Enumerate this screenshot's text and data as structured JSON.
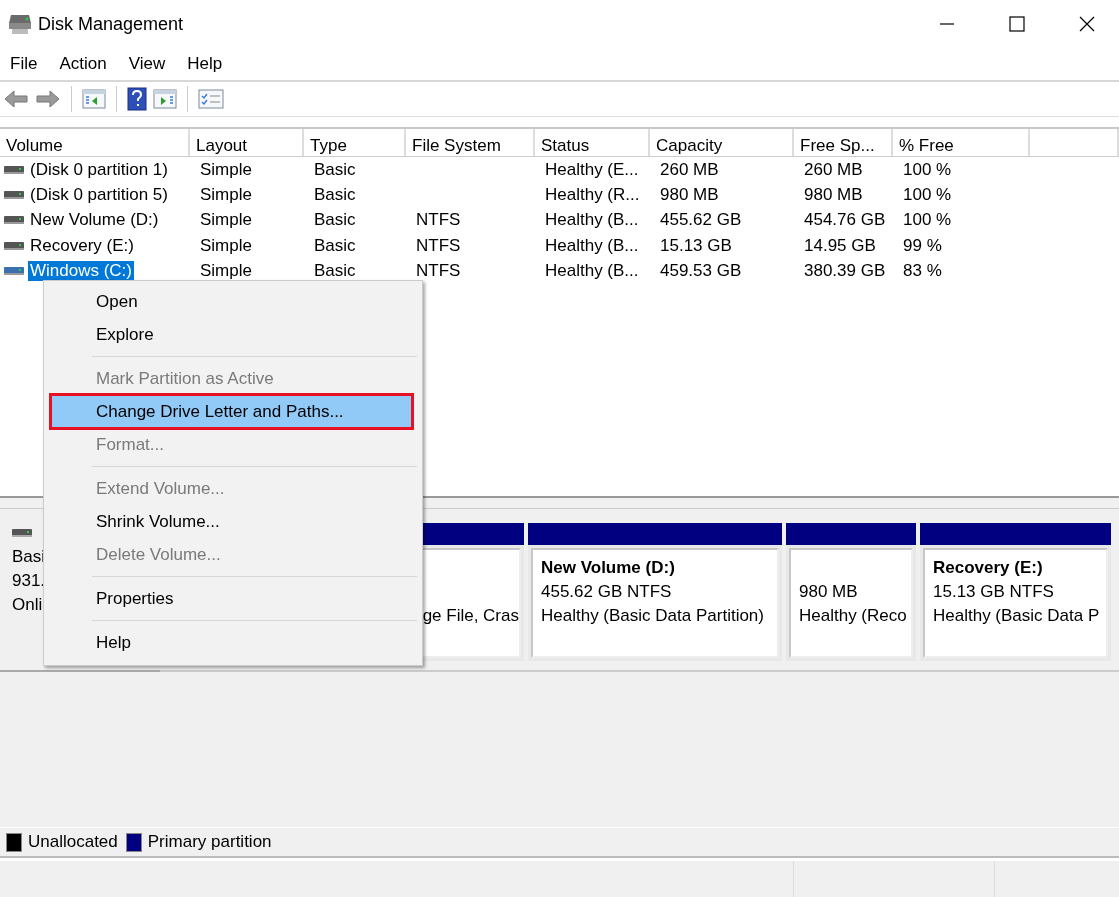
{
  "window": {
    "title": "Disk Management"
  },
  "menu_bar": [
    "File",
    "Action",
    "View",
    "Help"
  ],
  "table": {
    "columns": [
      "Volume",
      "Layout",
      "Type",
      "File System",
      "Status",
      "Capacity",
      "Free Sp...",
      "% Free"
    ],
    "rows": [
      {
        "cells": [
          "(Disk 0 partition 1)",
          "Simple",
          "Basic",
          "",
          "Healthy (E...",
          "260 MB",
          "260 MB",
          "100 %"
        ],
        "selected": false
      },
      {
        "cells": [
          "(Disk 0 partition 5)",
          "Simple",
          "Basic",
          "",
          "Healthy (R...",
          "980 MB",
          "980 MB",
          "100 %"
        ],
        "selected": false
      },
      {
        "cells": [
          "New Volume (D:)",
          "Simple",
          "Basic",
          "NTFS",
          "Healthy (B...",
          "455.62 GB",
          "454.76 GB",
          "100 %"
        ],
        "selected": false
      },
      {
        "cells": [
          "Recovery (E:)",
          "Simple",
          "Basic",
          "NTFS",
          "Healthy (B...",
          "15.13 GB",
          "14.95 GB",
          "99 %"
        ],
        "selected": false
      },
      {
        "cells": [
          "Windows (C:)",
          "Simple",
          "Basic",
          "NTFS",
          "Healthy (B...",
          "459.53 GB",
          "380.39 GB",
          "83 %"
        ],
        "selected": true
      }
    ]
  },
  "disk": {
    "lines": [
      "Basi",
      "931.",
      "Onli"
    ],
    "partitions": [
      {
        "lines": [
          "ge File, Cras"
        ],
        "kind": "covered"
      },
      {
        "name": "New Volume  (D:)",
        "lines": [
          "455.62 GB NTFS",
          "Healthy (Basic Data Partition)"
        ],
        "kind": "normal"
      },
      {
        "lines": [
          "980 MB",
          "Healthy (Reco"
        ],
        "kind": "normal"
      },
      {
        "name": "Recovery  (E:)",
        "lines": [
          "15.13 GB NTFS",
          "Healthy (Basic Data P"
        ],
        "kind": "normal"
      }
    ]
  },
  "legend": [
    {
      "label": "Unallocated",
      "color": "#000000"
    },
    {
      "label": "Primary partition",
      "color": "#000080"
    }
  ],
  "context_menu": [
    {
      "kind": "item",
      "label": "Open",
      "disabled": false,
      "selected": false,
      "outlined": false
    },
    {
      "kind": "item",
      "label": "Explore",
      "disabled": false,
      "selected": false,
      "outlined": false
    },
    {
      "kind": "separator"
    },
    {
      "kind": "item",
      "label": "Mark Partition as Active",
      "disabled": true,
      "selected": false,
      "outlined": false
    },
    {
      "kind": "item",
      "label": "Change Drive Letter and Paths...",
      "disabled": false,
      "selected": true,
      "outlined": true
    },
    {
      "kind": "item",
      "label": "Format...",
      "disabled": true,
      "selected": false,
      "outlined": false
    },
    {
      "kind": "separator"
    },
    {
      "kind": "item",
      "label": "Extend Volume...",
      "disabled": true,
      "selected": false,
      "outlined": false
    },
    {
      "kind": "item",
      "label": "Shrink Volume...",
      "disabled": false,
      "selected": false,
      "outlined": false
    },
    {
      "kind": "item",
      "label": "Delete Volume...",
      "disabled": true,
      "selected": false,
      "outlined": false
    },
    {
      "kind": "separator"
    },
    {
      "kind": "item",
      "label": "Properties",
      "disabled": false,
      "selected": false,
      "outlined": false
    },
    {
      "kind": "separator"
    },
    {
      "kind": "item",
      "label": "Help",
      "disabled": false,
      "selected": false,
      "outlined": false
    }
  ]
}
